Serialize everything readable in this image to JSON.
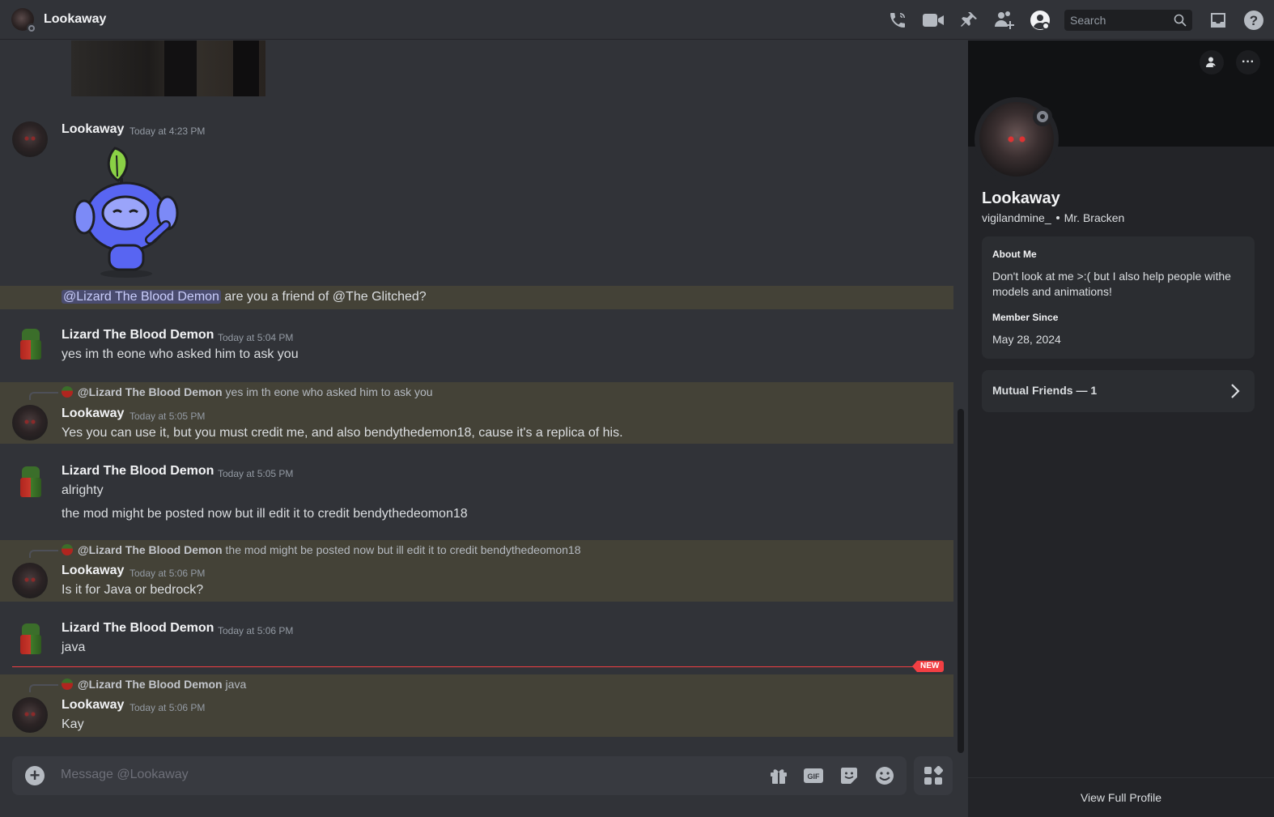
{
  "window": {
    "title": "Lookaway"
  },
  "topbar": {
    "icons": [
      "phone-call-icon",
      "video-call-icon",
      "pin-icon",
      "add-friends-icon",
      "user-profile-icon",
      "inbox-icon",
      "help-icon"
    ],
    "search_placeholder": "Search"
  },
  "messages": [
    {
      "user": "Lookaway",
      "time": "Today at 4:23 PM",
      "sticker": "wumpus-sprout-sticker"
    },
    {
      "mention": "@Lizard The Blood Demon",
      "text": "are you a friend of @The Glitched?"
    },
    {
      "user": "Lizard The Blood Demon",
      "time": "Today at 5:04 PM",
      "text": "yes im th eone who asked him to ask you"
    },
    {
      "reply_to": "@Lizard The Blood Demon",
      "reply_text": "yes im th eone who asked him to ask you",
      "user": "Lookaway",
      "time": "Today at 5:05 PM",
      "text": "Yes you can use it, but you must credit me, and also bendythedemon18, cause it's a replica of his."
    },
    {
      "user": "Lizard The Blood Demon",
      "time": "Today at 5:05 PM",
      "text": "alrighty",
      "text2": "the mod might be posted now but ill edit it to credit bendythedeomon18"
    },
    {
      "reply_to": "@Lizard The Blood Demon",
      "reply_text": "the mod might be posted now but ill edit it to credit bendythedeomon18",
      "user": "Lookaway",
      "time": "Today at 5:06 PM",
      "text": "Is it for Java or bedrock?"
    },
    {
      "user": "Lizard The Blood Demon",
      "time": "Today at 5:06 PM",
      "text": "java"
    },
    {
      "reply_to": "@Lizard The Blood Demon",
      "reply_text": "java",
      "user": "Lookaway",
      "time": "Today at 5:06 PM",
      "text": "Kay"
    }
  ],
  "new_badge": "NEW",
  "composer": {
    "placeholder": "Message @Lookaway",
    "icons": [
      "gift-icon",
      "gif-icon",
      "sticker-icon",
      "emoji-icon",
      "apps-icon"
    ],
    "gif_label": "GIF"
  },
  "profile": {
    "display_name": "Lookaway",
    "username": "vigilandmine_",
    "pronouns": "Mr. Bracken",
    "about_heading": "About Me",
    "about_text": "Don't look at me >:( but I also help people withe models and animations!",
    "member_since_heading": "Member Since",
    "member_since": "May 28, 2024",
    "mutual_friends": "Mutual Friends — 1",
    "view_full_profile": "View Full Profile"
  }
}
